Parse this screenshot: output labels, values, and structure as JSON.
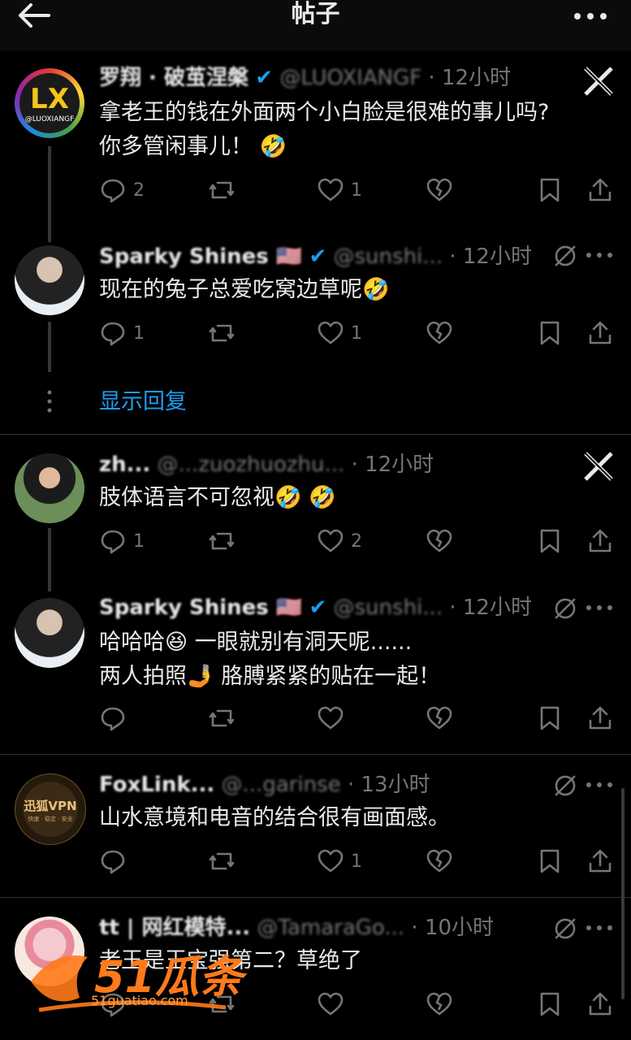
{
  "header": {
    "title": "帖子"
  },
  "colors": {
    "accent": "#1d9bf0",
    "muted": "#71767b",
    "text": "#e7e9ea"
  },
  "posts": [
    {
      "name": "罗翔 · 破茧涅槃",
      "handle": "@LUOXIANGF",
      "time": "· 12小时",
      "avatar_label": "LX",
      "avatar_sub": "@LUOXIANGF",
      "lines": [
        "拿老王的钱在外面两个小白脸是很难的事儿吗?",
        "你多管闲事儿！ 🤣"
      ],
      "replies": "2",
      "reposts": "",
      "likes": "1",
      "corner_icon": "x-logo-icon"
    },
    {
      "name": "Sparky Shines 🇺🇸",
      "handle": "@sunshi...",
      "time": "· 12小时",
      "lines": [
        "现在的兔子总爱吃窝边草呢🤣"
      ],
      "replies": "1",
      "reposts": "",
      "likes": "1",
      "corner_icon": "grok-icon"
    },
    {
      "name": "zh...",
      "handle": "@...zuozhuozhu...",
      "time": "· 12小时",
      "lines": [
        "肢体语言不可忽视🤣 🤣"
      ],
      "replies": "1",
      "reposts": "",
      "likes": "2",
      "corner_icon": "x-logo-icon"
    },
    {
      "name": "Sparky Shines 🇺🇸",
      "handle": "@sunshi...",
      "time": "· 12小时",
      "lines": [
        "哈哈哈😆 一眼就别有洞天呢......",
        "两人拍照🤳 胳膊紧紧的贴在一起！"
      ],
      "replies": "",
      "reposts": "",
      "likes": "",
      "corner_icon": "grok-icon"
    },
    {
      "name": "FoxLink...",
      "handle": "@...garinse",
      "time": "· 13小时",
      "avatar_label": "迅狐VPN",
      "avatar_sub": "快速 · 稳定 · 安全",
      "lines": [
        "山水意境和电音的结合很有画面感。"
      ],
      "replies": "",
      "reposts": "",
      "likes": "1",
      "corner_icon": "grok-icon"
    },
    {
      "name": "tt | 网红模特...",
      "handle": "@TamaraGo...",
      "time": "· 10小时",
      "lines": [
        "老王是王宝强第二？草绝了"
      ],
      "replies": "",
      "reposts": "",
      "likes": "",
      "corner_icon": "grok-icon"
    }
  ],
  "show_replies": "显示回复",
  "watermark": {
    "text": "51瓜条",
    "url": "51guatiao.com"
  }
}
